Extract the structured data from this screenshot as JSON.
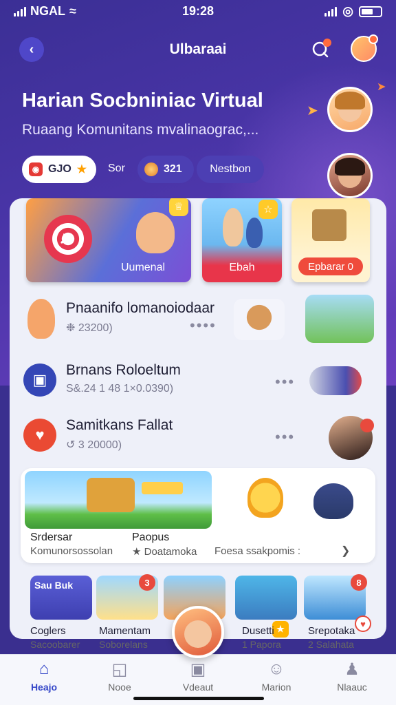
{
  "status_bar": {
    "carrier": "NGAL",
    "time": "19:28"
  },
  "header": {
    "title": "Ulbaraai"
  },
  "hero": {
    "title": "Harian Socbniniac Virtual",
    "subtitle": "Ruaang Komunitans mvalinaograc,..."
  },
  "stats": {
    "score": "GJO",
    "score_suffix": "Sor",
    "coins": "321",
    "neighbor": "Nestbon"
  },
  "cards": [
    {
      "label": "Uumenal"
    },
    {
      "label": "Ebah"
    },
    {
      "label": "Epbarar 0"
    }
  ],
  "list": [
    {
      "title": "Pnaanifo lomanoiodaar",
      "meta": "❉ 23200)",
      "more": "••••"
    },
    {
      "title": "Brnans Roloeltum",
      "meta": "S&.24 1 48 1×0.0390)",
      "more": "•••"
    },
    {
      "title": "Samitkans Fallat",
      "meta": "↺ 3 20000)",
      "more": "•••"
    }
  ],
  "featured": {
    "label_1": "Srdersar",
    "label_2": "Paopus",
    "meta_1": "Komunorsossolan",
    "meta_2": "★ Doatamoka",
    "meta_3": "Foesa ssakpomis :",
    "more_arrow": "❯"
  },
  "games": [
    {
      "banner": "Sau Buk",
      "title": "Coglers",
      "sub": "Sacoobarer"
    },
    {
      "badge": "3",
      "title": "Mamentam",
      "sub": "Soborelans"
    },
    {
      "title": "",
      "sub": ""
    },
    {
      "title": "Dusetti",
      "sub": "1 Papora"
    },
    {
      "badge": "8",
      "title": "Srepotaka",
      "sub": "2 Salahata"
    }
  ],
  "nav": [
    {
      "label": "Heajo",
      "icon": "home-icon"
    },
    {
      "label": "Nooe",
      "icon": "notice-icon"
    },
    {
      "label": "Vdeaut",
      "icon": "video-icon"
    },
    {
      "label": "Marion",
      "icon": "chat-icon"
    },
    {
      "label": "Nlaauc",
      "icon": "profile-icon"
    }
  ],
  "colors": {
    "hero_bg": "#3b2f95",
    "accent": "#3547c8",
    "badge_red": "#e84a3d"
  }
}
